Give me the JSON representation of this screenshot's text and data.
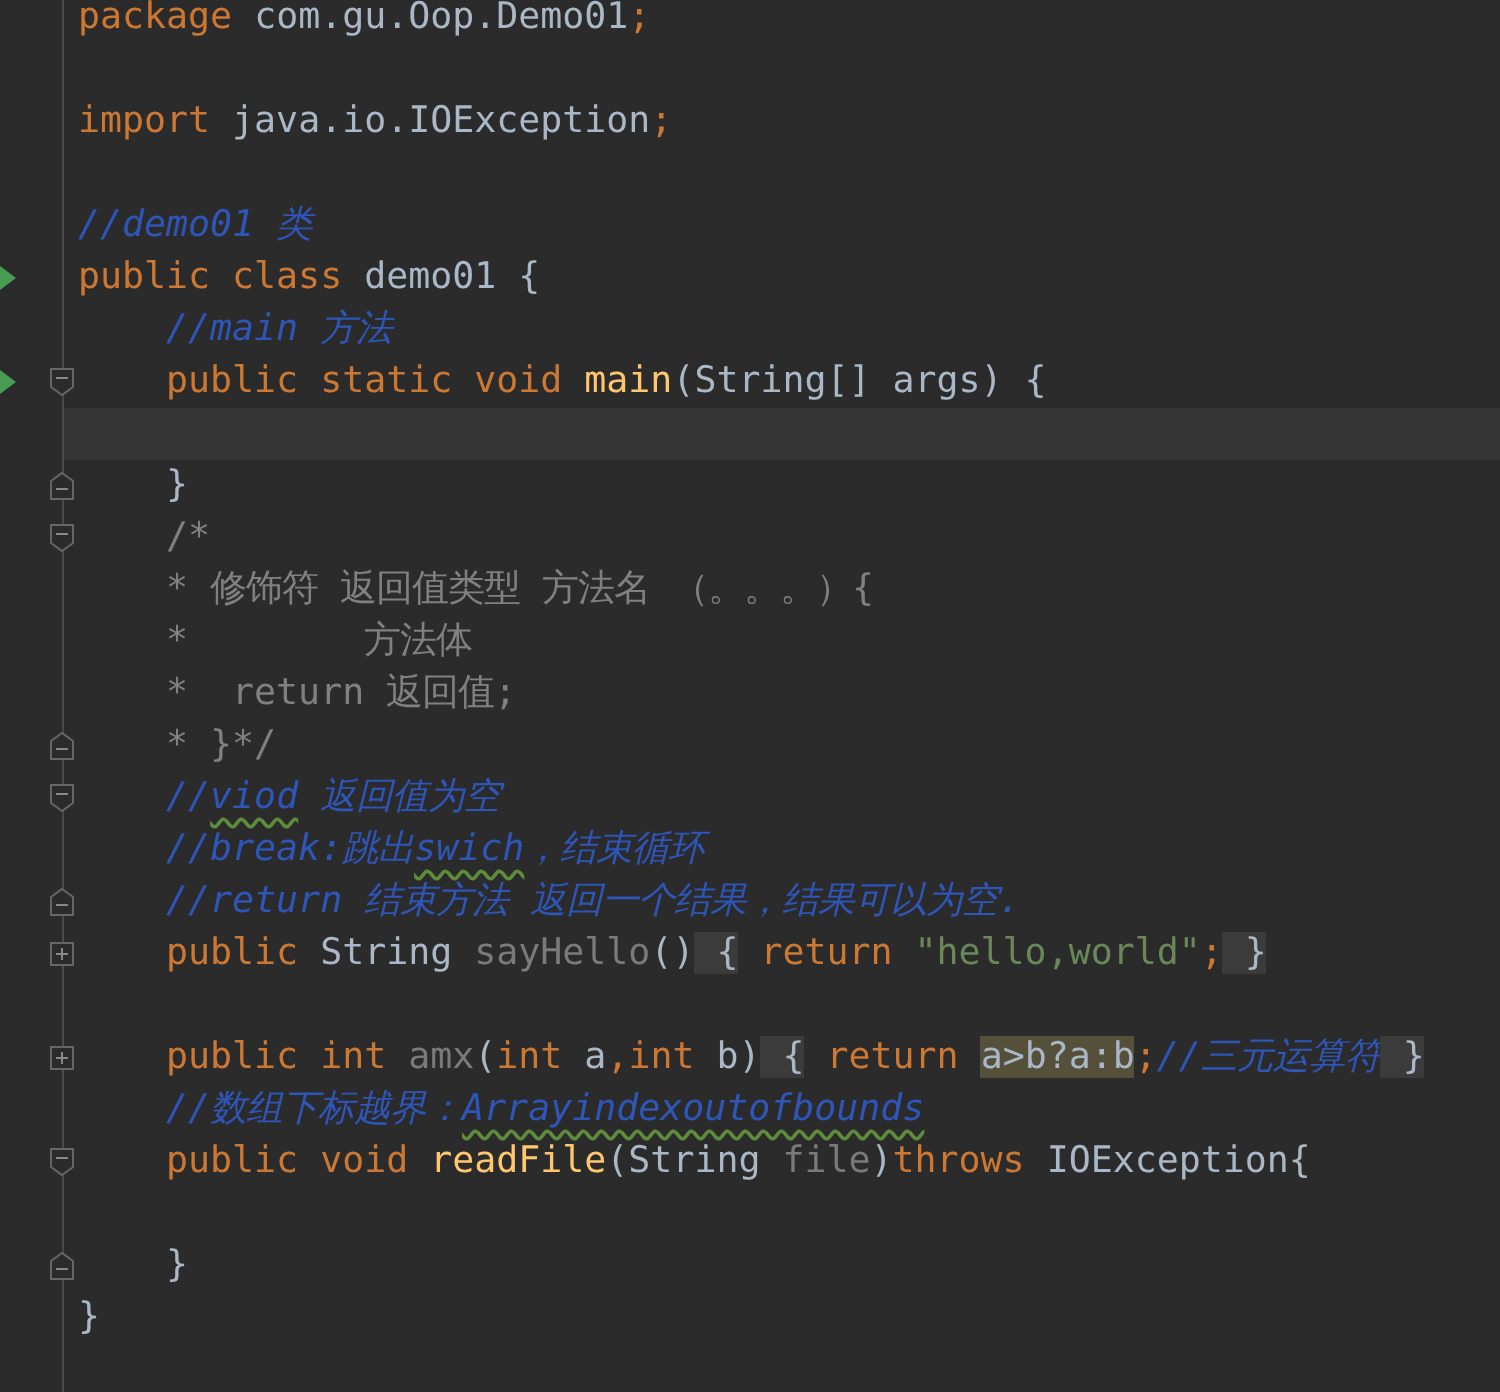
{
  "editor": {
    "lines": [
      {
        "current": false,
        "tokens": [
          {
            "t": "package ",
            "kind": "keyword"
          },
          {
            "t": "com.gu.Oop.Demo01",
            "kind": "plain"
          },
          {
            "t": ";",
            "kind": "keyword"
          }
        ]
      },
      {
        "current": false
      },
      {
        "current": false,
        "tokens": [
          {
            "t": "import ",
            "kind": "keyword"
          },
          {
            "t": "java.io.IOException",
            "kind": "plain"
          },
          {
            "t": ";",
            "kind": "keyword"
          }
        ]
      },
      {
        "current": false
      },
      {
        "current": false,
        "tokens": [
          {
            "t": "//demo01 类",
            "kind": "comment"
          }
        ]
      },
      {
        "current": false,
        "run": true,
        "tokens": [
          {
            "t": "public class ",
            "kind": "keyword"
          },
          {
            "t": "demo01 {",
            "kind": "plain"
          }
        ]
      },
      {
        "current": false,
        "tokens": [
          {
            "t": "    //main 方法",
            "kind": "comment"
          }
        ]
      },
      {
        "current": false,
        "run": true,
        "fold": {
          "kind": "open"
        },
        "tokens": [
          {
            "t": "    public static void ",
            "kind": "keyword"
          },
          {
            "t": "main",
            "kind": "method"
          },
          {
            "t": "(String[] args) {",
            "kind": "plain"
          }
        ]
      },
      {
        "current": true
      },
      {
        "current": false,
        "fold": {
          "kind": "close"
        },
        "tokens": [
          {
            "t": "    }",
            "kind": "plain"
          }
        ]
      },
      {
        "current": false,
        "fold": {
          "kind": "open"
        },
        "tokens": [
          {
            "t": "    /*",
            "kind": "doc"
          }
        ]
      },
      {
        "current": false,
        "tokens": [
          {
            "t": "    * 修饰符 返回值类型 方法名 （。。。）{",
            "kind": "doc"
          }
        ]
      },
      {
        "current": false,
        "tokens": [
          {
            "t": "    *        方法体",
            "kind": "doc"
          }
        ]
      },
      {
        "current": false,
        "tokens": [
          {
            "t": "    *  return 返回值;",
            "kind": "doc"
          }
        ]
      },
      {
        "current": false,
        "fold": {
          "kind": "close"
        },
        "tokens": [
          {
            "t": "    * }*/",
            "kind": "doc"
          }
        ]
      },
      {
        "current": false,
        "fold": {
          "kind": "open"
        },
        "tokens": [
          {
            "t": "    //",
            "kind": "comment"
          },
          {
            "t": "viod",
            "kind": "comment",
            "misspelled": true
          },
          {
            "t": " 返回值为空",
            "kind": "comment"
          }
        ]
      },
      {
        "current": false,
        "tokens": [
          {
            "t": "    //break:跳出",
            "kind": "comment"
          },
          {
            "t": "swich",
            "kind": "comment",
            "misspelled": true
          },
          {
            "t": "，结束循环",
            "kind": "comment"
          }
        ]
      },
      {
        "current": false,
        "fold": {
          "kind": "close"
        },
        "tokens": [
          {
            "t": "    //return 结束方法 返回一个结果，结果可以为空.",
            "kind": "comment"
          }
        ]
      },
      {
        "current": false,
        "fold": {
          "kind": "folded"
        },
        "tokens": [
          {
            "t": "    public ",
            "kind": "keyword"
          },
          {
            "t": "String ",
            "kind": "plain"
          },
          {
            "t": "sayHello",
            "kind": "unused"
          },
          {
            "t": "()",
            "kind": "plain"
          },
          {
            "t": " {",
            "kind": "plain",
            "collapsed": true
          },
          {
            "t": " return ",
            "kind": "keyword"
          },
          {
            "t": "\"hello,world\"",
            "kind": "string"
          },
          {
            "t": ";",
            "kind": "keyword"
          },
          {
            "t": " }",
            "kind": "plain",
            "collapsed": true
          }
        ]
      },
      {
        "current": false
      },
      {
        "current": false,
        "fold": {
          "kind": "folded"
        },
        "tokens": [
          {
            "t": "    public int ",
            "kind": "keyword"
          },
          {
            "t": "amx",
            "kind": "unused"
          },
          {
            "t": "(",
            "kind": "plain"
          },
          {
            "t": "int ",
            "kind": "keyword"
          },
          {
            "t": "a",
            "kind": "plain"
          },
          {
            "t": ",",
            "kind": "keyword"
          },
          {
            "t": "int ",
            "kind": "keyword"
          },
          {
            "t": "b)",
            "kind": "plain"
          },
          {
            "t": " {",
            "kind": "plain",
            "collapsed": true
          },
          {
            "t": " return ",
            "kind": "keyword"
          },
          {
            "t": "a>b?a:b",
            "kind": "plain",
            "highlighted": true
          },
          {
            "t": ";",
            "kind": "keyword"
          },
          {
            "t": "//三元运算符",
            "kind": "comment"
          },
          {
            "t": " }",
            "kind": "plain",
            "collapsed": true
          }
        ]
      },
      {
        "current": false,
        "tokens": [
          {
            "t": "    //数组下标越界：",
            "kind": "comment"
          },
          {
            "t": "Arrayindexoutofbounds",
            "kind": "comment",
            "misspelled": true
          }
        ]
      },
      {
        "current": false,
        "fold": {
          "kind": "open"
        },
        "tokens": [
          {
            "t": "    public void ",
            "kind": "keyword"
          },
          {
            "t": "readFile",
            "kind": "method"
          },
          {
            "t": "(String ",
            "kind": "plain"
          },
          {
            "t": "file",
            "kind": "unused"
          },
          {
            "t": ")",
            "kind": "plain"
          },
          {
            "t": "throws ",
            "kind": "keyword"
          },
          {
            "t": "IOException{",
            "kind": "plain"
          }
        ]
      },
      {
        "current": false
      },
      {
        "current": false,
        "fold": {
          "kind": "close"
        },
        "tokens": [
          {
            "t": "    }",
            "kind": "plain"
          }
        ]
      },
      {
        "current": false,
        "tokens": [
          {
            "t": "}",
            "kind": "plain"
          }
        ]
      }
    ]
  }
}
